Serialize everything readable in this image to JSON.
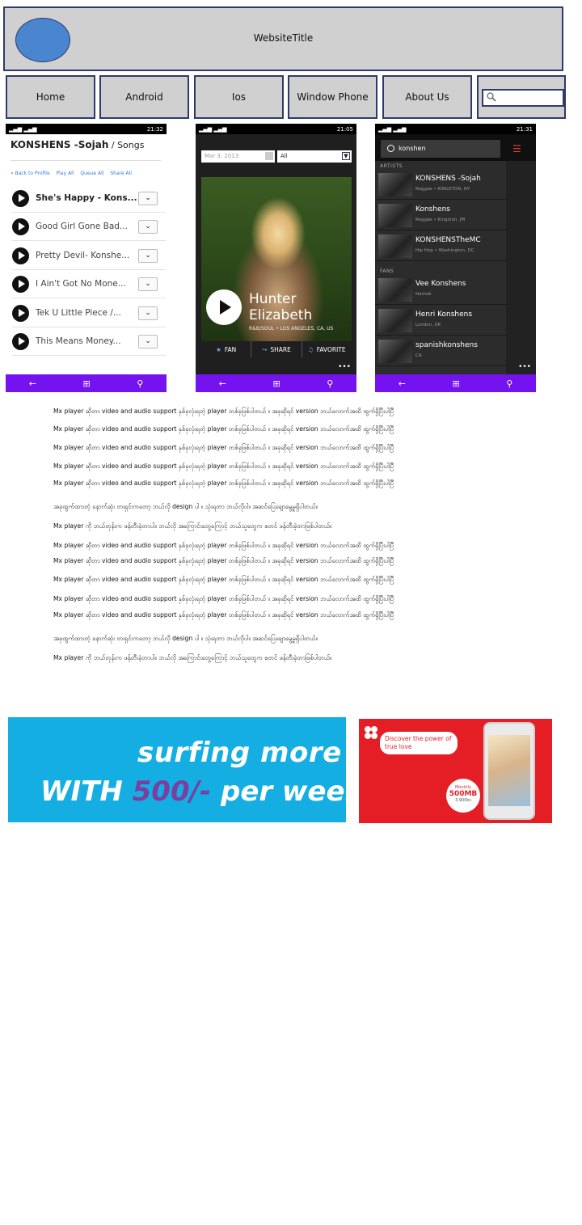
{
  "header": {
    "title": "WebsiteTitle"
  },
  "nav": [
    "Home",
    "Android",
    "Ios",
    "Window Phone",
    "About Us"
  ],
  "search": {
    "placeholder": ""
  },
  "phone1": {
    "status_time": "21:32",
    "title": "KONSHENS -Sojah",
    "title_suffix": " / Songs",
    "links": [
      "« Back to Profile",
      "Play All",
      "Queue All",
      "Share All"
    ],
    "songs": [
      "She's Happy - Kons...",
      "Good Girl Gone Bad...",
      "Pretty Devil- Konshe...",
      "I Ain't Got No Mone...",
      "Tek U Little Piece /...",
      "This Means Money..."
    ],
    "dropdown_glyph": "⌄"
  },
  "phone2": {
    "status_time": "21:05",
    "date": "Mar 3, 2013",
    "select": "All",
    "artist": "Hunter Elizabeth",
    "genre": "R&B/SOUL  •  LOS ANGELES, CA, US",
    "actions": [
      "FAN",
      "SHARE",
      "FAVORITE"
    ],
    "dots": "•••"
  },
  "phone3": {
    "status_time": "21:31",
    "query": "konshen",
    "section_artists": "ARTISTS",
    "section_fans": "FANS",
    "artists": [
      {
        "name": "KONSHENS -Sojah",
        "meta": "Reggae • KINGSTON, NY"
      },
      {
        "name": "Konshens",
        "meta": "Reggae • Kingston, JM"
      },
      {
        "name": "KONSHENSTheMC",
        "meta": "Hip Hop • Washington, DC"
      }
    ],
    "fans": [
      {
        "name": "Vee Konshens",
        "meta": "Nairobi"
      },
      {
        "name": "Henri Konshens",
        "meta": "London, UK"
      },
      {
        "name": "spanishkonshens",
        "meta": "CA"
      }
    ],
    "dots": "•••"
  },
  "navbar_glyphs": [
    "←",
    "⊞",
    "⚲"
  ],
  "body_text": {
    "repeat": "Mx player ဆိုတာ video and audio support နှစ်ခုလုံးရတဲ့ player တစ်ခုဖြစ်ပါတယ် ။ အခုဆိုရင် version ဘယ်လောက်အထိ ထွက်ရှိပြီးပါပြီ",
    "para_a": "အခုထွက်ထားတဲ့ နောက်ဆုံး ဗားရှင်းကတော့ ဘယ်လို design ပါ ။ သုံးရတာ ဘယ်လိုပါ။ အဆင်ပြေချောမွေ့မှုရှိပါတယ်။",
    "para_b": "Mx player ကို ဘယ်တုန်းက ဖန်တီးခဲ့တာပါ။ ဘယ်လို အကြောင်းတွေကြောင့် ဘယ်သူတွေက စတင် ဖန်တီးခဲ့တာဖြစ်ပါတယ်။"
  },
  "ads": {
    "ad1_line1": "surfing more",
    "ad1_line2_a": "WITH ",
    "ad1_line2_price": "500/-",
    "ad1_line2_b": " per week",
    "ad2_bubble": "Discover the power of true love",
    "ad2_badge_top": "Monthly",
    "ad2_badge_main": "500MB",
    "ad2_badge_price": "3,900ks"
  }
}
